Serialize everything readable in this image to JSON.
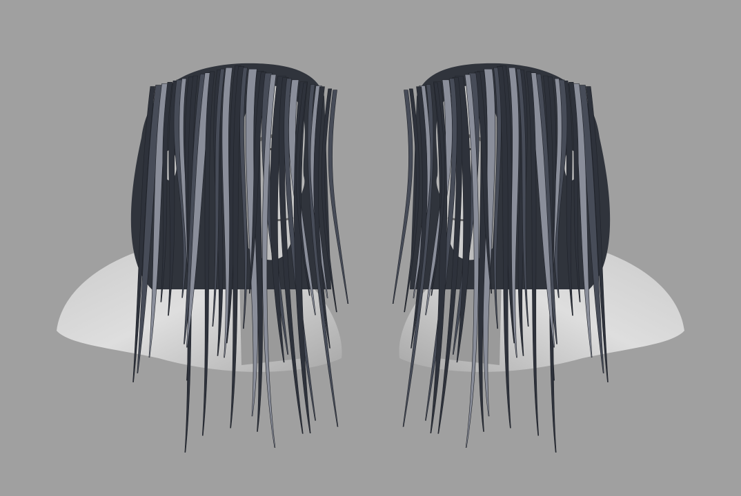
{
  "colors": {
    "background": "#a0a0a0",
    "skin_light": "#d8d8d8",
    "skin_mid": "#b4b4b4",
    "skin_dark": "#7e7e7e",
    "hair_dark": "#2e323b",
    "hair_mid": "#474c58",
    "hair_light": "#8a8e9a"
  }
}
